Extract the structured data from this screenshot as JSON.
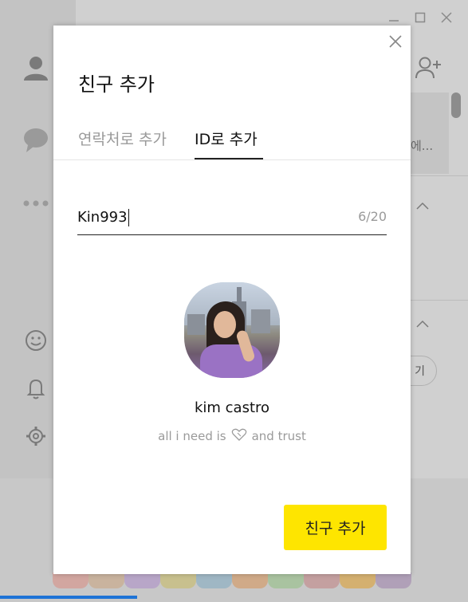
{
  "background_app": {
    "sidebar_icons": [
      "person-icon",
      "chat-bubble-icon",
      "more-dots-icon",
      "emoji-icon",
      "bell-icon",
      "gear-icon"
    ],
    "window_controls": [
      "minimize-icon",
      "maximize-icon",
      "close-icon"
    ],
    "preview_text": "에...",
    "pill_text": "기"
  },
  "dialog": {
    "title": "친구 추가",
    "tabs": [
      {
        "label": "연락처로 추가",
        "active": false
      },
      {
        "label": "ID로 추가",
        "active": true
      }
    ],
    "id_field": {
      "value": "Kin993",
      "counter": "6/20"
    },
    "profile": {
      "name": "kim castro",
      "status_before": "all i need is",
      "status_icon": "heart-icon",
      "status_after": "and trust"
    },
    "add_button_label": "친구 추가",
    "close_icon": "close-icon"
  },
  "colors": {
    "accent_yellow": "#fee500",
    "overlay_grey": "#c3c3c3"
  }
}
